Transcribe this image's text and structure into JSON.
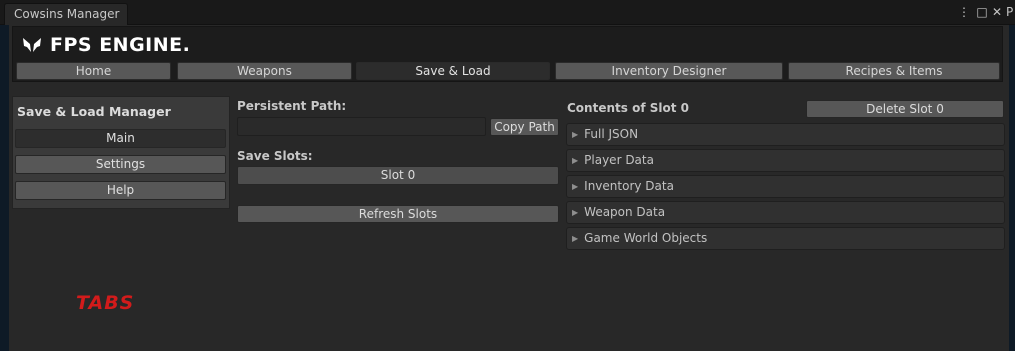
{
  "window": {
    "tab_title": "Cowsins Manager",
    "menu_icon": "⋮",
    "maximize_icon": "□",
    "close_icon": "✕",
    "cut_text": "P"
  },
  "header": {
    "logo_title": "FPS ENGINE.",
    "nav": [
      {
        "label": "Home",
        "active": false
      },
      {
        "label": "Weapons",
        "active": false
      },
      {
        "label": "Save & Load",
        "active": true
      },
      {
        "label": "Inventory Designer",
        "active": false
      },
      {
        "label": "Recipes & Items",
        "active": false
      }
    ]
  },
  "left_panel": {
    "title": "Save & Load Manager",
    "buttons": [
      {
        "label": "Main",
        "active": true
      },
      {
        "label": "Settings",
        "active": false
      },
      {
        "label": "Help",
        "active": false
      }
    ]
  },
  "middle": {
    "persistent_path_label": "Persistent Path:",
    "persistent_path_value": "",
    "copy_path_label": "Copy Path",
    "save_slots_label": "Save Slots:",
    "slots": [
      "Slot 0"
    ],
    "refresh_label": "Refresh Slots"
  },
  "right": {
    "contents_title": "Contents of Slot 0",
    "delete_label": "Delete Slot 0",
    "sections": [
      "Full JSON",
      "Player Data",
      "Inventory Data",
      "Weapon Data",
      "Game World Objects"
    ]
  },
  "tabs_label": "TABS",
  "colors": {
    "tabs_label": "#d21b1b",
    "active_nav": "#2c2c2c",
    "button": "#585858"
  }
}
